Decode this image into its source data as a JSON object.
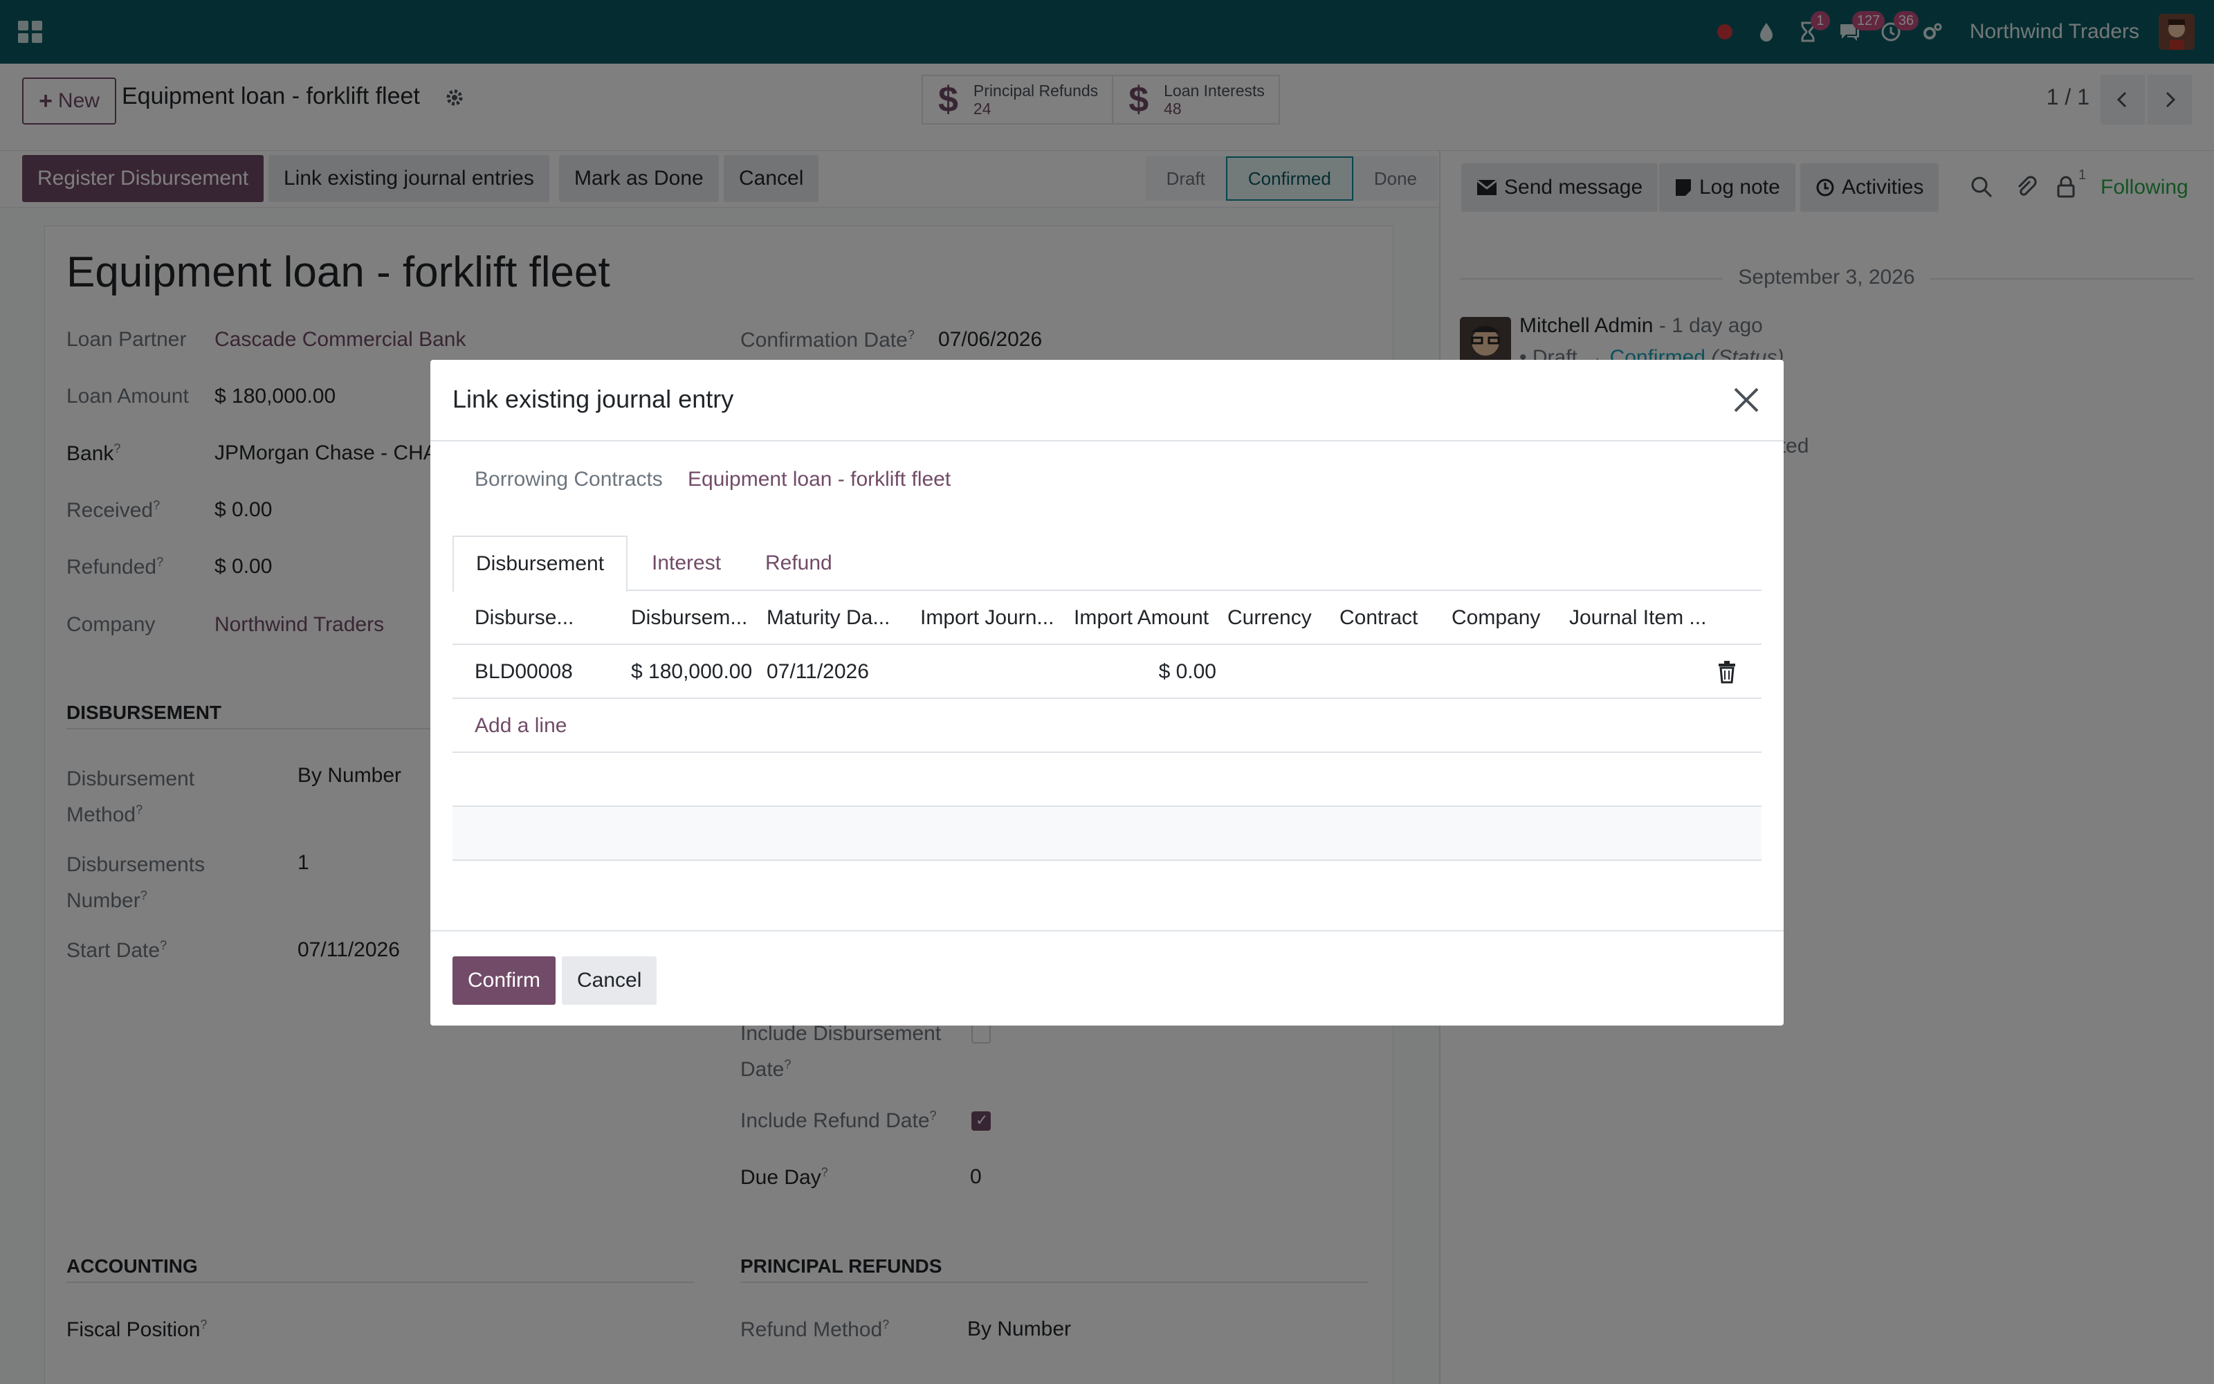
{
  "navbar": {
    "company": "Northwind Traders",
    "badges": {
      "activities": "1",
      "messages": "127",
      "clock": "36"
    }
  },
  "control": {
    "new_label": "New",
    "breadcrumb": "Equipment loan - forklift fleet",
    "smart_buttons": [
      {
        "label": "Principal Refunds",
        "value": "24"
      },
      {
        "label": "Loan Interests",
        "value": "48"
      }
    ],
    "pager": "1 / 1"
  },
  "statusbar": {
    "buttons": [
      "Register Disbursement",
      "Link existing journal entries",
      "Mark as Done",
      "Cancel"
    ],
    "stages": [
      "Draft",
      "Confirmed",
      "Done"
    ],
    "active_stage": "Confirmed"
  },
  "form": {
    "title": "Equipment loan - forklift fleet",
    "loan_partner_label": "Loan Partner",
    "loan_partner": "Cascade Commercial Bank",
    "loan_amount_label": "Loan Amount",
    "loan_amount": "$ 180,000.00",
    "bank_label": "Bank",
    "bank": "JPMorgan Chase - CHA",
    "received_label": "Received",
    "received": "$ 0.00",
    "refunded_label": "Refunded",
    "refunded": "$ 0.00",
    "company_label": "Company",
    "company": "Northwind Traders",
    "confirmation_date_label": "Confirmation Date",
    "confirmation_date": "07/06/2026",
    "disbursement_section": "DISBURSEMENT",
    "disbursement_method_label_1": "Disbursement",
    "disbursement_method_label_2": "Method",
    "disbursement_method": "By Number",
    "disbursements_number_label_1": "Disbursements",
    "disbursements_number_label_2": "Number",
    "disbursements_number": "1",
    "start_date_label": "Start Date",
    "start_date": "07/11/2026",
    "include_disb_date_label_1": "Include Disbursement",
    "include_disb_date_label_2": "Date",
    "include_disb_date": false,
    "include_refund_date_label": "Include Refund Date",
    "include_refund_date": true,
    "due_day_label": "Due Day",
    "due_day": "0",
    "accounting_section": "ACCOUNTING",
    "fiscal_position_label": "Fiscal Position",
    "principal_refunds_section": "PRINCIPAL REFUNDS",
    "refund_method_label": "Refund Method",
    "refund_method": "By Number"
  },
  "chatter": {
    "send_message": "Send message",
    "log_note": "Log note",
    "activities": "Activities",
    "followers_count": "1",
    "following": "Following",
    "date": "September 3, 2026",
    "author": "Mitchell Admin",
    "time": "- 1 day ago",
    "tracking_old": "Draft",
    "tracking_new": "Confirmed",
    "tracking_field": "(Status)",
    "tail": "ated"
  },
  "modal": {
    "title": "Link existing journal entry",
    "contract_label": "Borrowing Contracts",
    "contract_value": "Equipment loan - forklift fleet",
    "tabs": [
      "Disbursement",
      "Interest",
      "Refund"
    ],
    "active_tab": "Disbursement",
    "columns": [
      "Disburse...",
      "Disbursem...",
      "Maturity Da...",
      "Import Journ...",
      "Import Amount",
      "Currency",
      "Contract",
      "Company",
      "Journal Item ..."
    ],
    "rows": [
      {
        "ref": "BLD00008",
        "amount": "$ 180,000.00",
        "maturity": "07/11/2026",
        "import_journal": "",
        "import_amount": "$ 0.00",
        "currency": "",
        "contract": "",
        "company": "",
        "journal_item": ""
      }
    ],
    "add_line": "Add a line",
    "confirm": "Confirm",
    "cancel": "Cancel"
  },
  "colors": {
    "navbar": "#0b5b63",
    "primary": "#714b67",
    "following": "#28a745"
  }
}
